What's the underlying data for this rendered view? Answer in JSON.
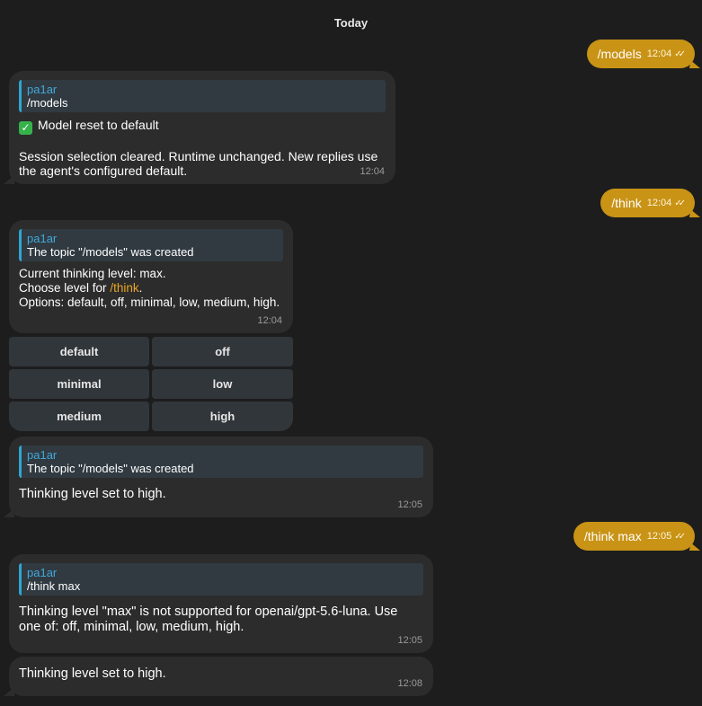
{
  "date_separator": "Today",
  "messages": {
    "out1": {
      "text": "/models",
      "time": "12:04"
    },
    "in1": {
      "reply_author": "pa1ar",
      "reply_quote": "/models",
      "title": "Model reset to default",
      "body": "Session selection cleared. Runtime unchanged. New replies use the agent's configured default.",
      "time": "12:04"
    },
    "out2": {
      "text": "/think",
      "time": "12:04"
    },
    "in2": {
      "reply_author": "pa1ar",
      "reply_quote": "The topic \"/models\" was created",
      "line1": "Current thinking level: max.",
      "line2_prefix": "Choose level for ",
      "line2_link": "/think",
      "line2_suffix": ".",
      "line3": "Options: default, off, minimal, low, medium, high.",
      "time": "12:04"
    },
    "keyboard": [
      "default",
      "off",
      "minimal",
      "low",
      "medium",
      "high"
    ],
    "in3": {
      "reply_author": "pa1ar",
      "reply_quote": "The topic \"/models\" was created",
      "body": "Thinking level set to high.",
      "time": "12:05"
    },
    "out3": {
      "text": "/think max",
      "time": "12:05"
    },
    "in4": {
      "reply_author": "pa1ar",
      "reply_quote": "/think max",
      "body": "Thinking level \"max\" is not supported for openai/gpt-5.6-luna. Use one of: off, minimal, low, medium, high.",
      "time": "12:05"
    },
    "in5": {
      "body": "Thinking level set to high.",
      "time": "12:08"
    }
  },
  "colors": {
    "outgoing": "#c99316",
    "incoming": "#2c2c2c",
    "reply_bar": "#2ea6d2",
    "link": "#e8a623",
    "background": "#1d1d1d"
  },
  "icons": {
    "read_receipt": "double-check-icon",
    "status": "check-mark-emoji"
  }
}
